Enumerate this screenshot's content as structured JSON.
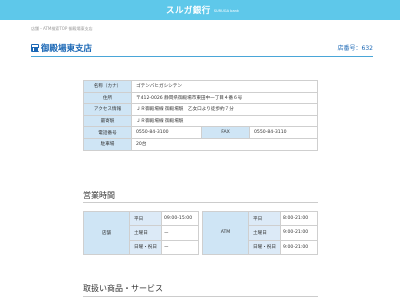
{
  "header": {
    "logo_text": "スルガ銀行",
    "logo_sub": "SURUGA bank"
  },
  "breadcrumb": "店舗・ATM検索TOP  御殿場東支店",
  "page": {
    "title": "御殿場東支店",
    "store_no": "店番号：632"
  },
  "info": {
    "rows": [
      {
        "label": "名称（カナ）",
        "value": "ゴテンバヒガシシテン"
      },
      {
        "label": "住所",
        "value": "〒412-0026 静岡県御殿場市東田中一丁目４番６号"
      },
      {
        "label": "アクセス情報",
        "value": "ＪＲ御殿場線 御殿場駅　乙女口より徒歩約７分"
      },
      {
        "label": "最寄駅",
        "value": "ＪＲ御殿場線 御殿場駅"
      },
      {
        "label": "電話番号",
        "value": "0550-84-3100",
        "label2": "FAX",
        "value2": "0550-84-3110"
      },
      {
        "label": "駐車場",
        "value": "20台"
      }
    ]
  },
  "hours_section": {
    "title": "営業時間",
    "branch": {
      "label": "店舗",
      "rows": [
        {
          "day": "平日",
          "time": "09:00-15:00"
        },
        {
          "day": "土曜日",
          "time": "ー"
        },
        {
          "day": "日曜・祝日",
          "time": "ー"
        }
      ]
    },
    "atm": {
      "label": "ATM",
      "rows": [
        {
          "day": "平日",
          "time": "8:00-21:00"
        },
        {
          "day": "土曜日",
          "time": "9:00-21:00"
        },
        {
          "day": "日曜・祝日",
          "time": "9:00-21:00"
        }
      ]
    }
  },
  "products_section": {
    "title": "取扱い商品・サービス"
  },
  "colors": {
    "header_bg": "#5ec8ea",
    "accent": "#1a67b5",
    "label_bg": "#cfe5f5"
  }
}
